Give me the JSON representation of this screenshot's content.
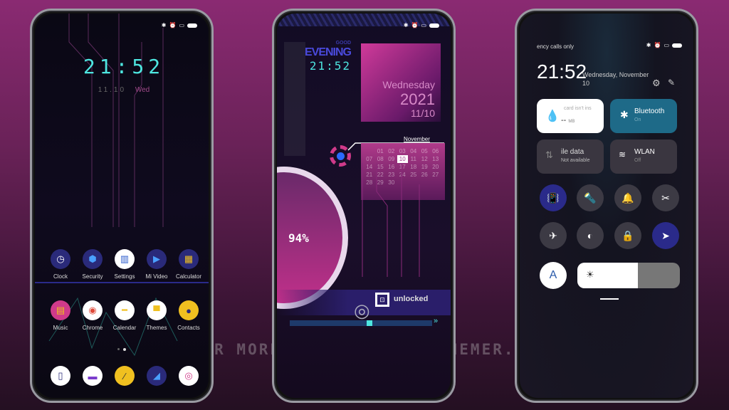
{
  "watermark": "VISIT FOR MORE THEMES - MIUITHEMER.COM",
  "colors": {
    "accent_cyan": "#4ee6e0",
    "accent_pink": "#c0308a",
    "accent_blue": "#2a2a8a",
    "bluetooth_tile": "#1e6a88"
  },
  "status_icons": [
    "bluetooth-icon",
    "alarm-icon",
    "sim-icon",
    "battery-icon"
  ],
  "home": {
    "time": "21:52",
    "date": "11.10",
    "weekday": "Wed",
    "apps_row1": [
      {
        "label": "Clock",
        "icon": "clock-icon"
      },
      {
        "label": "Security",
        "icon": "security-icon"
      },
      {
        "label": "Settings",
        "icon": "settings-icon"
      },
      {
        "label": "Mi Video",
        "icon": "video-icon"
      },
      {
        "label": "Calculator",
        "icon": "calculator-icon"
      }
    ],
    "apps_row2": [
      {
        "label": "Music",
        "icon": "music-icon"
      },
      {
        "label": "Chrome",
        "icon": "chrome-icon"
      },
      {
        "label": "Calendar",
        "icon": "calendar-icon"
      },
      {
        "label": "Themes",
        "icon": "themes-icon"
      },
      {
        "label": "Contacts",
        "icon": "contacts-icon"
      }
    ],
    "dock": [
      {
        "icon": "phone-icon"
      },
      {
        "icon": "messages-icon"
      },
      {
        "icon": "notes-icon"
      },
      {
        "icon": "gallery-icon"
      },
      {
        "icon": "camera-icon"
      }
    ]
  },
  "lock": {
    "greeting_small": "GOOD",
    "greeting": "EVENING",
    "time": "21:52",
    "weekday": "Wednesday",
    "year": "2021",
    "date": "11/10",
    "month": "November",
    "calendar": [
      [
        "",
        "01",
        "02",
        "03",
        "04",
        "05",
        "06"
      ],
      [
        "07",
        "08",
        "09",
        "10",
        "11",
        "12",
        "13"
      ],
      [
        "14",
        "15",
        "16",
        "17",
        "18",
        "19",
        "20"
      ],
      [
        "21",
        "22",
        "23",
        "24",
        "25",
        "26",
        "27"
      ],
      [
        "28",
        "29",
        "30",
        "",
        "",
        "",
        ""
      ]
    ],
    "today": "10",
    "battery": "94%",
    "status": "unlocked"
  },
  "control": {
    "carrier": "ency calls only",
    "time": "21:52",
    "date": "Wednesday, November 10",
    "data_tile": {
      "title": "card isn't ins",
      "value": "--",
      "unit": "MB"
    },
    "bluetooth": {
      "title": "Bluetooth",
      "state": "On"
    },
    "mobile_data": {
      "title": "ile data",
      "state": "Not available"
    },
    "wlan": {
      "title": "WLAN",
      "state": "Off"
    },
    "auto_brightness": "A",
    "brightness_percent": 59
  }
}
